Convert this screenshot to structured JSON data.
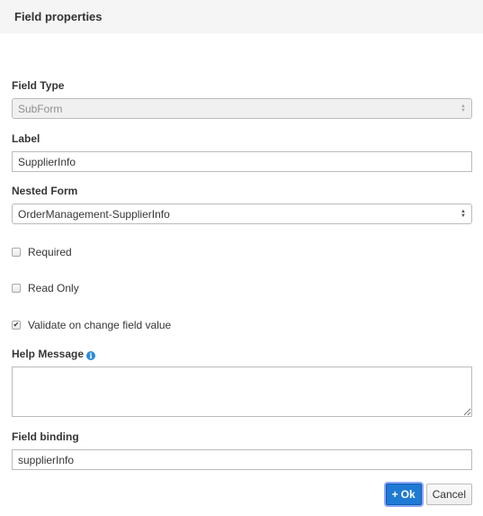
{
  "dialog": {
    "title": "Field properties"
  },
  "fields": {
    "field_type": {
      "label": "Field Type",
      "value": "SubForm",
      "disabled": true
    },
    "label": {
      "label": "Label",
      "value": "SupplierInfo"
    },
    "nested_form": {
      "label": "Nested Form",
      "value": "OrderManagement-SupplierInfo"
    },
    "required": {
      "label": "Required",
      "checked": false
    },
    "read_only": {
      "label": "Read Only",
      "checked": false
    },
    "validate_on_change": {
      "label": "Validate on change field value",
      "checked": true,
      "check_glyph": "✔"
    },
    "help_message": {
      "label": "Help Message",
      "info_glyph": "i",
      "value": ""
    },
    "field_binding": {
      "label": "Field binding",
      "value": "supplierInfo"
    }
  },
  "footer": {
    "ok_icon": "+",
    "ok_label": "Ok",
    "cancel_label": "Cancel"
  },
  "icons": {
    "select_up": "▲",
    "select_down": "▼"
  },
  "colors": {
    "primary": "#1f7ad4",
    "info": "#2d8ad9",
    "header_bg": "#f5f5f5"
  }
}
